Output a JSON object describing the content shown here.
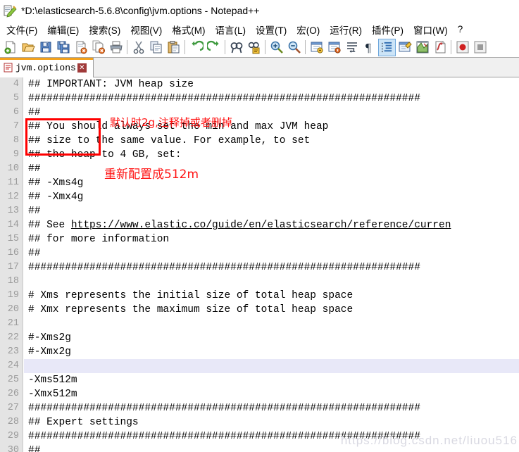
{
  "window": {
    "title": "*D:\\elasticsearch-5.6.8\\config\\jvm.options - Notepad++",
    "app_icon": "notepad-plus-plus-icon"
  },
  "menubar": {
    "items": [
      {
        "label": "文件(F)",
        "name": "menu-file"
      },
      {
        "label": "编辑(E)",
        "name": "menu-edit"
      },
      {
        "label": "搜索(S)",
        "name": "menu-search"
      },
      {
        "label": "视图(V)",
        "name": "menu-view"
      },
      {
        "label": "格式(M)",
        "name": "menu-format"
      },
      {
        "label": "语言(L)",
        "name": "menu-language"
      },
      {
        "label": "设置(T)",
        "name": "menu-settings"
      },
      {
        "label": "宏(O)",
        "name": "menu-macro"
      },
      {
        "label": "运行(R)",
        "name": "menu-run"
      },
      {
        "label": "插件(P)",
        "name": "menu-plugins"
      },
      {
        "label": "窗口(W)",
        "name": "menu-window"
      },
      {
        "label": "?",
        "name": "menu-help"
      }
    ]
  },
  "toolbar": {
    "buttons": [
      {
        "name": "new-file-icon",
        "title": "新建"
      },
      {
        "name": "open-file-icon",
        "title": "打开"
      },
      {
        "name": "save-icon",
        "title": "保存"
      },
      {
        "name": "save-all-icon",
        "title": "保存所有"
      },
      {
        "name": "close-file-icon",
        "title": "关闭"
      },
      {
        "name": "close-all-icon",
        "title": "关闭所有"
      },
      {
        "name": "print-icon",
        "title": "打印"
      },
      {
        "name": "separator-1",
        "title": ""
      },
      {
        "name": "cut-icon",
        "title": "剪切"
      },
      {
        "name": "copy-icon",
        "title": "复制"
      },
      {
        "name": "paste-icon",
        "title": "粘贴"
      },
      {
        "name": "separator-2",
        "title": ""
      },
      {
        "name": "undo-icon",
        "title": "撤销"
      },
      {
        "name": "redo-icon",
        "title": "重做"
      },
      {
        "name": "separator-3",
        "title": ""
      },
      {
        "name": "find-icon",
        "title": "查找"
      },
      {
        "name": "replace-icon",
        "title": "替换"
      },
      {
        "name": "separator-4",
        "title": ""
      },
      {
        "name": "zoom-in-icon",
        "title": "放大"
      },
      {
        "name": "zoom-out-icon",
        "title": "缩小"
      },
      {
        "name": "separator-5",
        "title": ""
      },
      {
        "name": "sync-vertical-icon",
        "title": "同步垂直滚动"
      },
      {
        "name": "sync-horizontal-icon",
        "title": "同步水平滚动"
      },
      {
        "name": "word-wrap-icon",
        "title": "自动换行"
      },
      {
        "name": "show-all-chars-icon",
        "title": "显示所有字符"
      },
      {
        "name": "indent-guide-icon",
        "title": "缩进参考线",
        "active": true
      },
      {
        "name": "user-defined-language-icon",
        "title": "用户自定义语言"
      },
      {
        "name": "document-map-icon",
        "title": "文档地图"
      },
      {
        "name": "function-list-icon",
        "title": "函数列表"
      },
      {
        "name": "separator-6",
        "title": ""
      },
      {
        "name": "record-macro-icon",
        "title": "开始录制宏"
      },
      {
        "name": "stop-macro-icon",
        "title": "停止录制宏"
      }
    ]
  },
  "tabs": [
    {
      "label": "jvm.options",
      "icon": "modified-document-icon",
      "close": "✕",
      "active": true
    }
  ],
  "editor": {
    "current_line": 24,
    "lines": [
      {
        "n": "4",
        "text": "## IMPORTANT: JVM heap size"
      },
      {
        "n": "5",
        "text": "################################################################"
      },
      {
        "n": "6",
        "text": "##"
      },
      {
        "n": "7",
        "text": "## You should always set the min and max JVM heap"
      },
      {
        "n": "8",
        "text": "## size to the same value. For example, to set"
      },
      {
        "n": "9",
        "text": "## the heap to 4 GB, set:"
      },
      {
        "n": "10",
        "text": "##"
      },
      {
        "n": "11",
        "text": "## -Xms4g"
      },
      {
        "n": "12",
        "text": "## -Xmx4g"
      },
      {
        "n": "13",
        "text": "##"
      },
      {
        "n": "14",
        "text": "## See ",
        "url": "https://www.elastic.co/guide/en/elasticsearch/reference/curren"
      },
      {
        "n": "15",
        "text": "## for more information"
      },
      {
        "n": "16",
        "text": "##"
      },
      {
        "n": "17",
        "text": "################################################################"
      },
      {
        "n": "18",
        "text": ""
      },
      {
        "n": "19",
        "text": "# Xms represents the initial size of total heap space"
      },
      {
        "n": "20",
        "text": "# Xmx represents the maximum size of total heap space"
      },
      {
        "n": "21",
        "text": ""
      },
      {
        "n": "22",
        "text": "#-Xms2g"
      },
      {
        "n": "23",
        "text": "#-Xmx2g"
      },
      {
        "n": "24",
        "text": ""
      },
      {
        "n": "25",
        "text": "-Xms512m"
      },
      {
        "n": "26",
        "text": "-Xmx512m"
      },
      {
        "n": "27",
        "text": "################################################################"
      },
      {
        "n": "28",
        "text": "## Expert settings"
      },
      {
        "n": "29",
        "text": "################################################################"
      },
      {
        "n": "30",
        "text": "##"
      }
    ]
  },
  "annotations": [
    {
      "name": "annotation-default-2g",
      "text": "默认时2g,注释掉或者删掉",
      "color": "#ff1111"
    },
    {
      "name": "annotation-reconfigure-512m",
      "text": "重新配置成512m",
      "color": "#ff1111"
    }
  ],
  "highlight_boxes": [
    {
      "name": "red-highlight-box-xms2g",
      "color": "#ff0000"
    }
  ],
  "watermark": {
    "text": "https://blog.csdn.net/liuou516"
  }
}
